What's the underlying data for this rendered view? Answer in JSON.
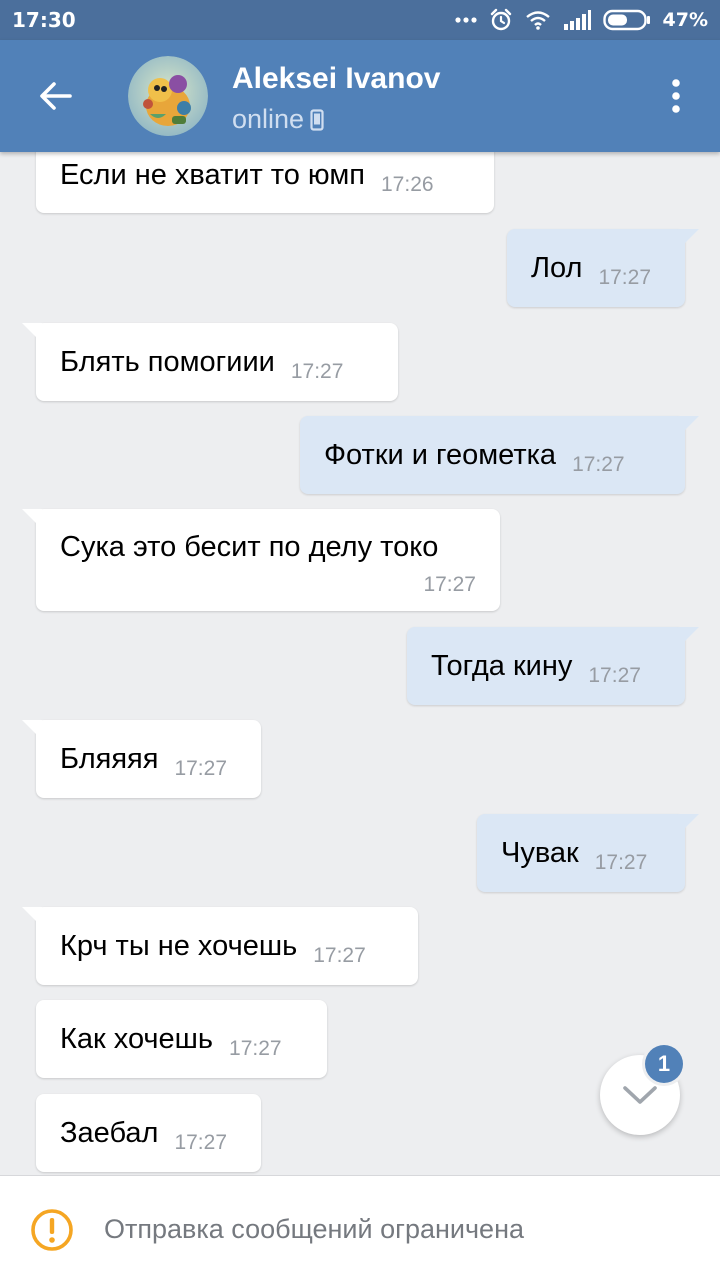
{
  "status_bar": {
    "time": "17:30",
    "battery": "47%",
    "icons": [
      "more-dots-icon",
      "alarm-icon",
      "wifi-icon",
      "signal-icon",
      "battery-icon"
    ]
  },
  "header": {
    "contact_name": "Aleksei Ivanov",
    "presence": "online",
    "icons": [
      "back-arrow-icon",
      "avatar",
      "mobile-icon",
      "overflow-menu-icon"
    ]
  },
  "messages": [
    {
      "direction": "in",
      "text": "Если не хватит то юмп",
      "time": "17:26"
    },
    {
      "direction": "out",
      "text": "Лол",
      "time": "17:27"
    },
    {
      "direction": "in",
      "text": "Блять помогиии",
      "time": "17:27"
    },
    {
      "direction": "out",
      "text": "Фотки и геометка",
      "time": "17:27"
    },
    {
      "direction": "in",
      "text": "Сука это бесит по делу токо",
      "time": "17:27"
    },
    {
      "direction": "out",
      "text": "Тогда кину",
      "time": "17:27"
    },
    {
      "direction": "in",
      "text": "Бляяяя",
      "time": "17:27"
    },
    {
      "direction": "out",
      "text": "Чувак",
      "time": "17:27"
    },
    {
      "direction": "in",
      "text": "Крч ты не хочешь",
      "time": "17:27"
    },
    {
      "direction": "in",
      "text": "Как хочешь",
      "time": "17:27"
    },
    {
      "direction": "in",
      "text": "Заебал",
      "time": "17:27"
    }
  ],
  "scroll_button": {
    "unread_count": "1",
    "icon": "chevron-down-icon"
  },
  "footer": {
    "restriction_text": "Отправка сообщений ограничена",
    "icon": "warning-icon"
  },
  "colors": {
    "status_bar": "#4b6f9c",
    "toolbar": "#5181b8",
    "background": "#edeef0",
    "incoming_bubble": "#ffffff",
    "outgoing_bubble": "#dbe7f5",
    "time_text": "#979ca3",
    "warning": "#f5a623",
    "badge": "#5181b8"
  }
}
